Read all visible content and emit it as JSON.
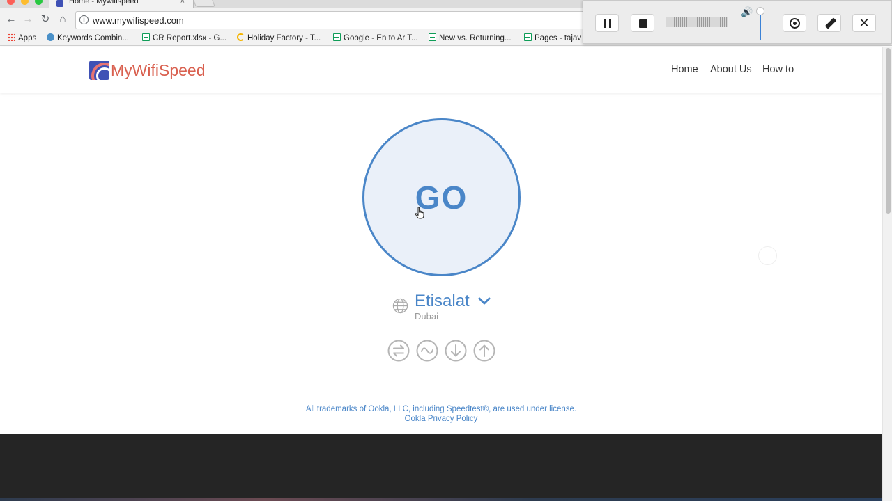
{
  "browser": {
    "tab_title": "Home - Mywifispeed",
    "tab_close": "×",
    "url": "www.mywifispeed.com",
    "bookmarks": [
      "Apps",
      "Keywords Combin...",
      "CR Report.xlsx - G...",
      "Holiday Factory - T...",
      "Google - En to Ar T...",
      "New vs. Returning...",
      "Pages - tajav"
    ]
  },
  "recorder": {
    "close_label": "✕"
  },
  "site": {
    "logo_text": "MyWifiSpeed",
    "nav": [
      "Home",
      "About Us",
      "How to"
    ]
  },
  "speedtest": {
    "go_label": "GO",
    "isp_name": "Etisalat",
    "isp_city": "Dubai",
    "notice_line1": "All trademarks of Ookla, LLC, including Speedtest®, are used under license.",
    "privacy_link": "Ookla Privacy Policy"
  },
  "colors": {
    "accent": "#4a86c8",
    "logo_text": "#d9604f",
    "footer": "#252525"
  }
}
